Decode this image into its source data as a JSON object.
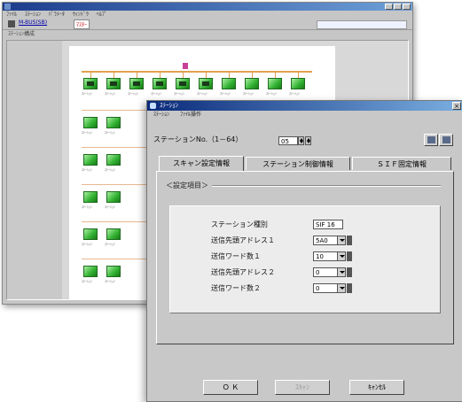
{
  "back_window": {
    "menu": [
      "ﾌｧｲﾙ",
      "ｽﾃｰｼｮﾝ",
      "ﾊﾟﾗﾒｰﾀ",
      "ｳｨﾝﾄﾞｳ",
      "ﾍﾙﾌﾟ"
    ],
    "toolbar_link": "M-BUS(SB)",
    "toolbar_tag": "ﾏｽﾀｰ",
    "path": "ｽﾃｰｼｮﾝ構成",
    "node_label": "ｽﾃｰｼｮﾝ"
  },
  "dialog": {
    "title": "ｽﾃｰｼｮﾝ",
    "close_label": "×",
    "menu": [
      "ｽﾃｰｼｮﾝ",
      "ﾌｧｲﾙ操作"
    ],
    "station_label": "ステーションNo.（1－64）",
    "station_value": "05",
    "tabs": [
      "スキャン設定情報",
      "ステーション制御情報",
      "ＳＩＦ固定情報"
    ],
    "group_title": "＜設定項目＞",
    "fields": [
      {
        "label": "ステーション種別",
        "value": "SIF 16"
      },
      {
        "label": "送信先頭アドレス１",
        "value": "5A0"
      },
      {
        "label": "送信ワード数１",
        "value": "10"
      },
      {
        "label": "送信先頭アドレス２",
        "value": "0"
      },
      {
        "label": "送信ワード数２",
        "value": "0"
      }
    ],
    "buttons": {
      "ok": "Ｏ Ｋ",
      "apply": "ｽｷｬﾝ",
      "cancel": "ｷｬﾝｾﾙ"
    }
  }
}
